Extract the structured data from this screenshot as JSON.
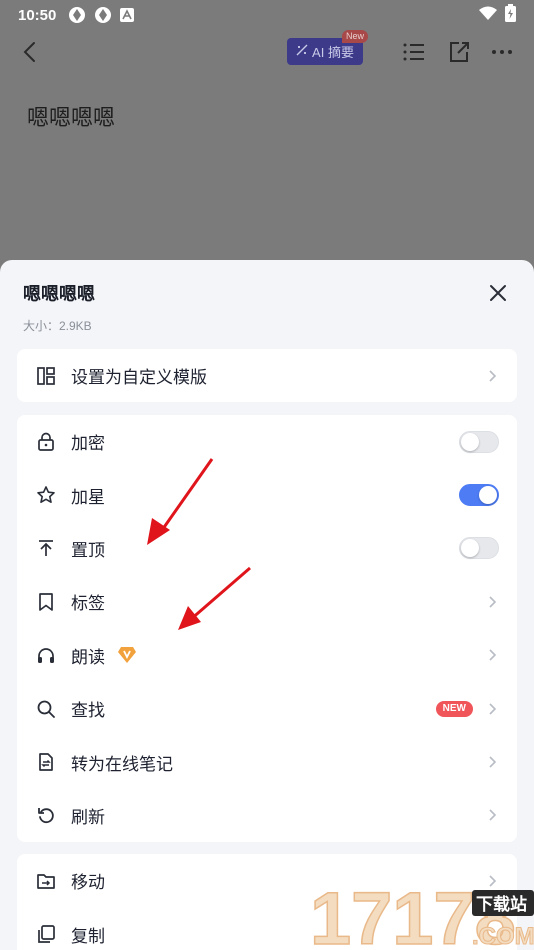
{
  "status": {
    "time": "10:50"
  },
  "appbar": {
    "ai_label": "AI 摘要",
    "ai_new": "New"
  },
  "document": {
    "title": "嗯嗯嗯嗯"
  },
  "sheet": {
    "title": "嗯嗯嗯嗯",
    "size": "大小：2.9KB",
    "template_item": {
      "label": "设置为自定义模版"
    },
    "items": [
      {
        "label": "加密",
        "icon": "lock-icon",
        "control": "toggle",
        "on": false
      },
      {
        "label": "加星",
        "icon": "star-icon",
        "control": "toggle",
        "on": true
      },
      {
        "label": "置顶",
        "icon": "pin-top-icon",
        "control": "toggle",
        "on": false
      },
      {
        "label": "标签",
        "icon": "bookmark-icon",
        "control": "chevron"
      },
      {
        "label": "朗读",
        "icon": "headphones-icon",
        "control": "chevron",
        "badge": "vip"
      },
      {
        "label": "查找",
        "icon": "search-icon",
        "control": "chevron",
        "badge_text": "NEW"
      },
      {
        "label": "转为在线笔记",
        "icon": "convert-doc-icon",
        "control": "chevron"
      },
      {
        "label": "刷新",
        "icon": "refresh-icon",
        "control": "chevron"
      }
    ],
    "more_items": [
      {
        "label": "移动",
        "icon": "move-folder-icon"
      },
      {
        "label": "复制",
        "icon": "copy-icon"
      }
    ]
  },
  "watermark": {
    "number": "17178",
    "site": "下载站",
    "domain": ".COM"
  },
  "colors": {
    "accent": "#4d7cf5",
    "new_badge": "#f0555a",
    "vip": "#f2a23c",
    "arrow": "#e0141b"
  }
}
